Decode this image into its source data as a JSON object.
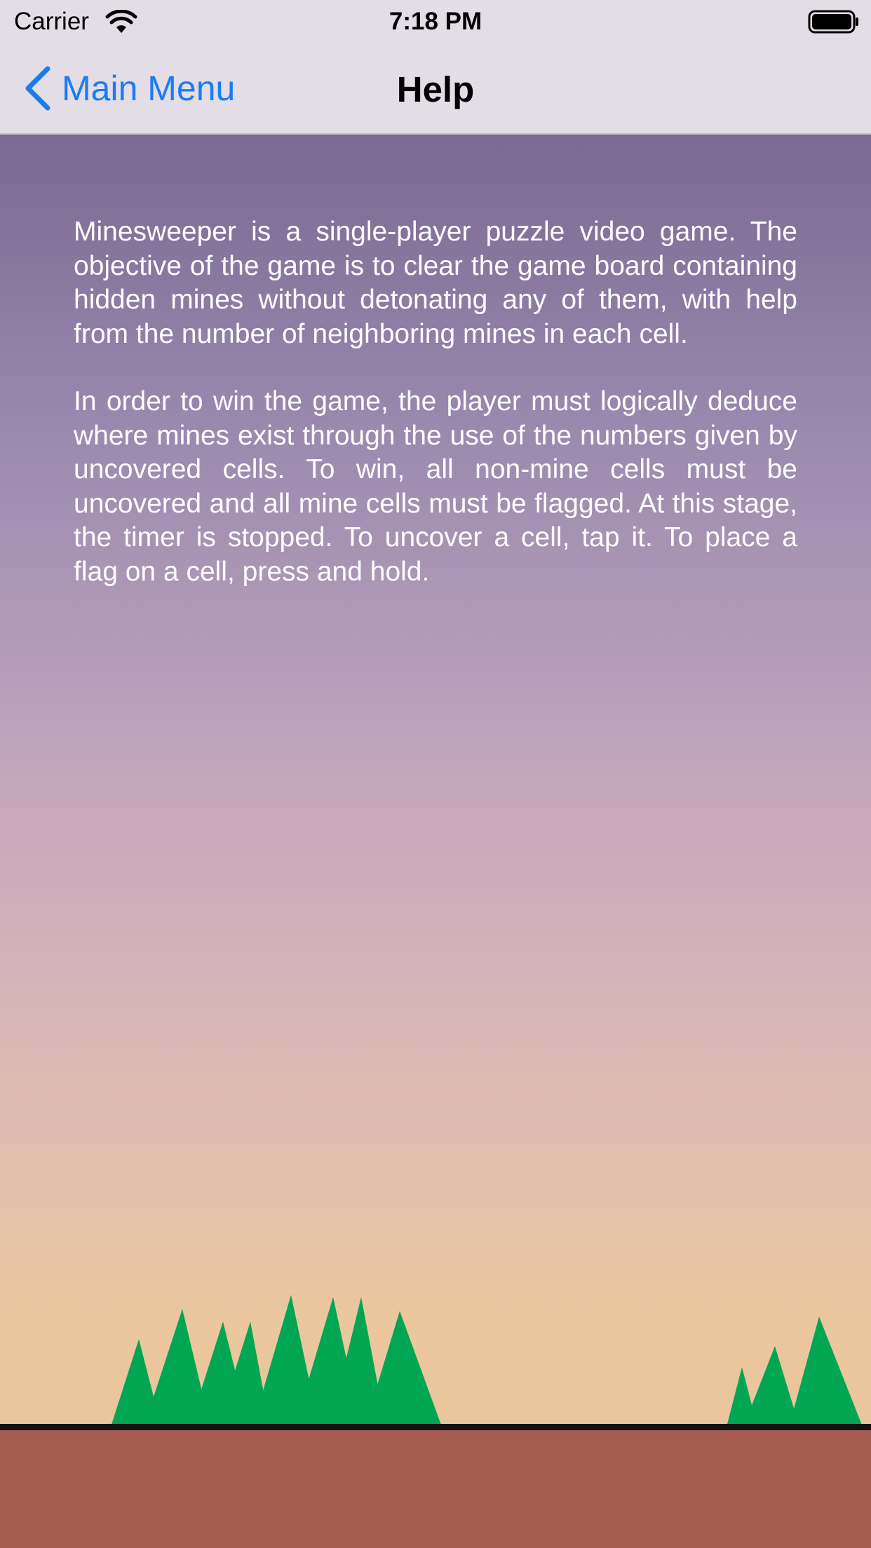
{
  "status_bar": {
    "carrier": "Carrier",
    "time": "7:18 PM"
  },
  "nav_bar": {
    "back_label": "Main Menu",
    "title": "Help"
  },
  "help": {
    "paragraphs": [
      "Minesweeper is a single-player puzzle video game. The objective of the game is to clear the game board containing hidden mines without detonating any of them, with help from the number of neighboring mines in each cell.",
      "In order to win the game, the player must logically deduce where mines exist through the use of the numbers given by uncovered cells. To win, all non-mine cells must be uncovered and all mine cells must be flagged. At this stage, the timer is stopped. To uncover a cell, tap it. To place a flag on a cell, press and hold."
    ]
  },
  "colors": {
    "accent": "#1a7cf5",
    "tree": "#00a651",
    "ground": "#a65c4f"
  },
  "icons": [
    "wifi-icon",
    "battery-icon",
    "chevron-left-icon"
  ]
}
